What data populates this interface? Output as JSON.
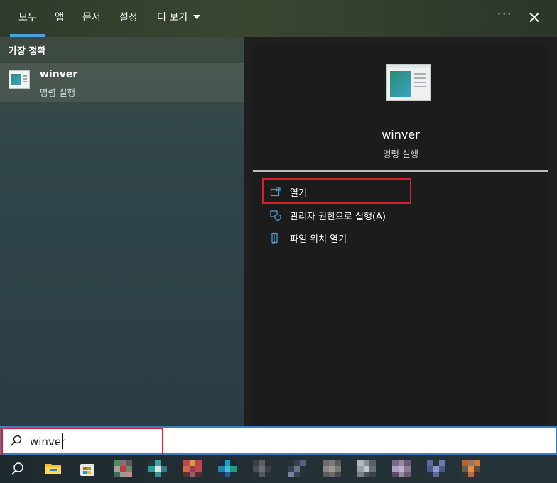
{
  "tabs": [
    {
      "label": "모두",
      "active": true
    },
    {
      "label": "앱",
      "active": false
    },
    {
      "label": "문서",
      "active": false
    },
    {
      "label": "설정",
      "active": false
    }
  ],
  "more_tab": {
    "label": "더 보기"
  },
  "more_options": {
    "label": "···"
  },
  "best_match": {
    "heading": "가장 정확",
    "title": "winver",
    "subtitle": "명령 실행"
  },
  "detail": {
    "title": "winver",
    "subtitle": "명령 실행",
    "actions": [
      {
        "label": "열기",
        "icon": "open-icon"
      },
      {
        "label": "관리자 권한으로 실행(A)",
        "icon": "shield-icon"
      },
      {
        "label": "파일 위치 열기",
        "icon": "folder-icon"
      }
    ]
  },
  "search": {
    "value": "winver"
  },
  "taskbar": {
    "icons": [
      "search-icon",
      "file-explorer-icon",
      "store-icon",
      "app-icon",
      "app-icon",
      "app-icon",
      "app-icon",
      "app-icon",
      "app-icon",
      "app-icon",
      "app-icon",
      "app-icon",
      "app-icon",
      "app-icon"
    ]
  },
  "colors": {
    "accent": "#4aa3df",
    "highlight": "#d91e2e",
    "pane_dark": "#1f1f1f"
  }
}
